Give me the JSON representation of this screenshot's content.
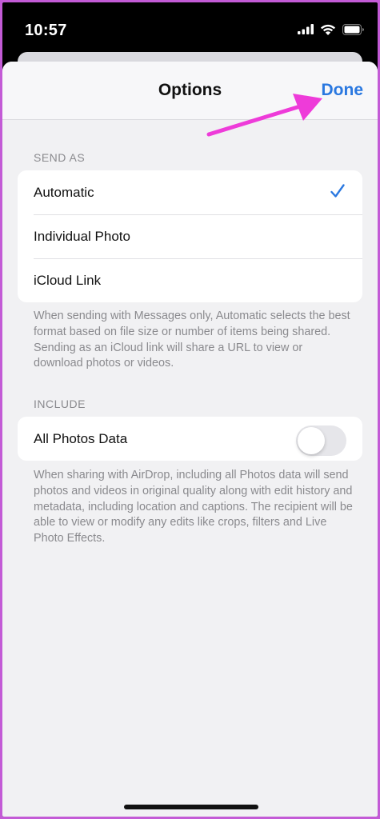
{
  "status_bar": {
    "time": "10:57",
    "icons": [
      "cellular-signal-icon",
      "wifi-icon",
      "battery-icon"
    ]
  },
  "nav": {
    "title": "Options",
    "done_label": "Done"
  },
  "send_as": {
    "header": "SEND AS",
    "options": [
      {
        "label": "Automatic",
        "selected": true
      },
      {
        "label": "Individual Photo",
        "selected": false
      },
      {
        "label": "iCloud Link",
        "selected": false
      }
    ],
    "footer": "When sending with Messages only, Automatic selects the best format based on file size or number of items being shared. Sending as an iCloud link will share a URL to view or download photos or videos."
  },
  "include": {
    "header": "INCLUDE",
    "option_label": "All Photos Data",
    "toggle_on": false,
    "footer": "When sharing with AirDrop, including all Photos data will send photos and videos in original quality along with edit history and metadata, including location and captions. The recipient will be able to view or modify any edits like crops, filters and Live Photo Effects."
  },
  "colors": {
    "accent": "#2a78e0",
    "annotation_arrow": "#ee3bd9",
    "frame_border": "#c35bd6"
  }
}
